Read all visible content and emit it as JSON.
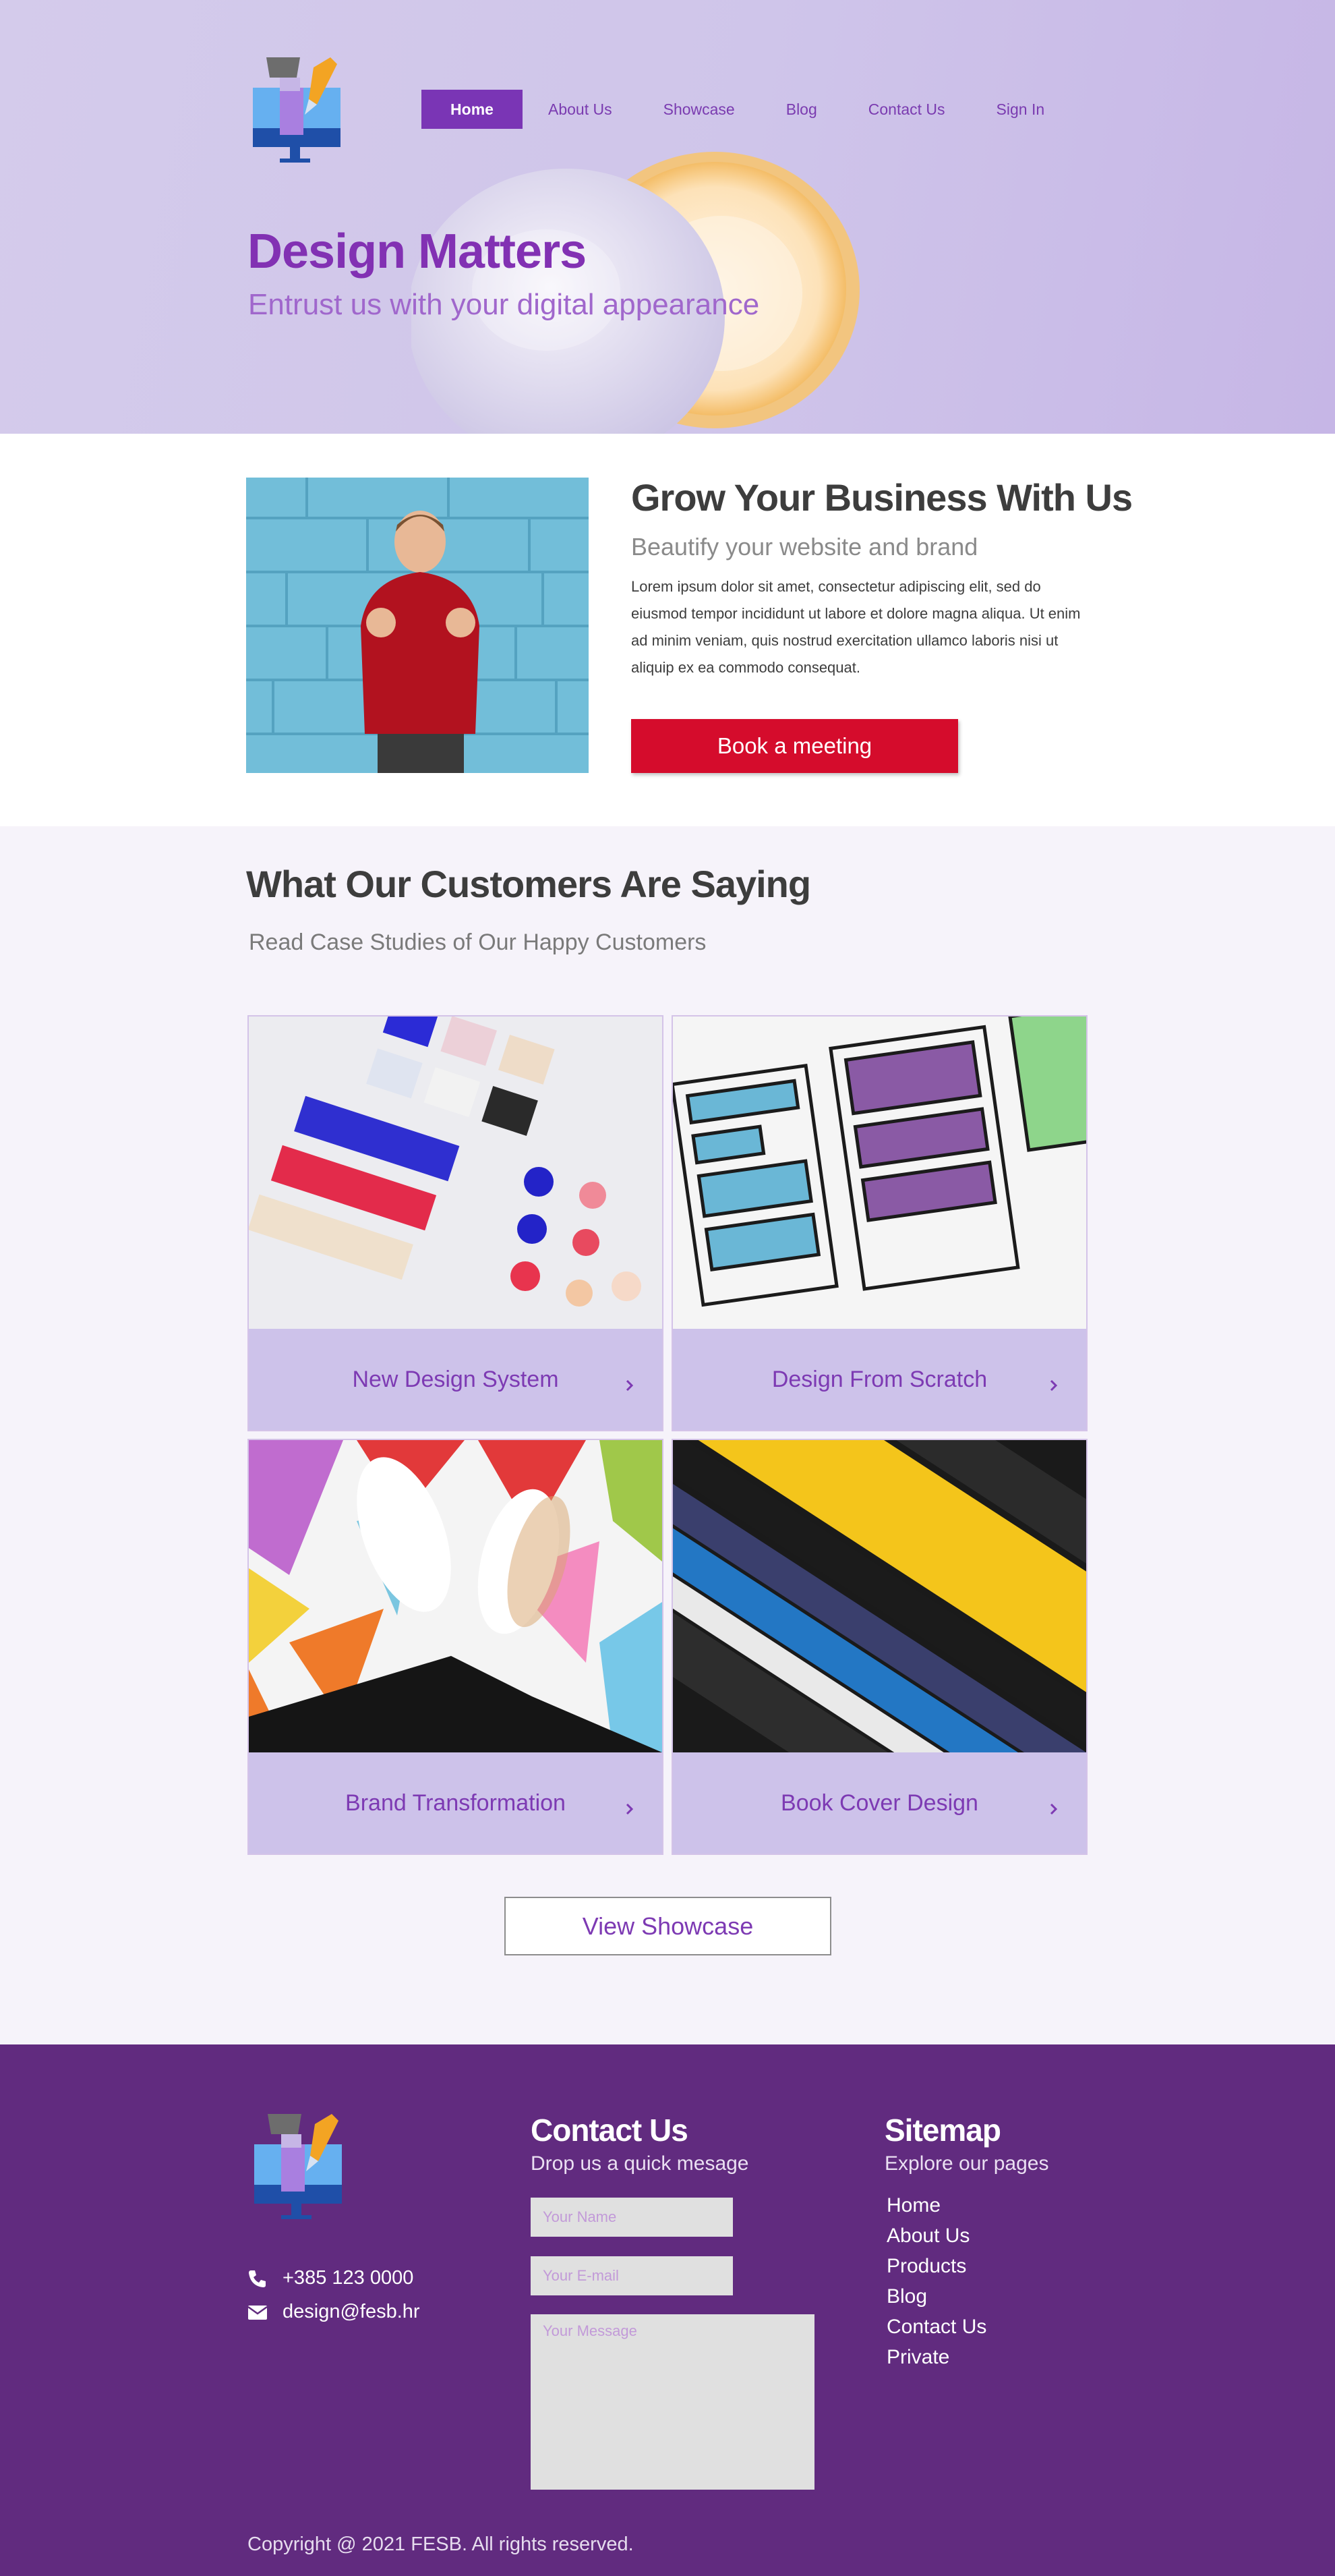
{
  "nav": {
    "items": [
      "Home",
      "About Us",
      "Showcase",
      "Blog",
      "Contact Us",
      "Sign In"
    ],
    "active": "Home"
  },
  "hero": {
    "title": "Design Matters",
    "subtitle": "Entrust us with your digital appearance"
  },
  "grow": {
    "title": "Grow Your Business With Us",
    "subtitle": "Beautify your website and brand",
    "body": "Lorem ipsum dolor sit amet, consectetur adipiscing elit, sed do eiusmod tempor incididunt ut labore et dolore magna aliqua. Ut enim ad minim veniam, quis nostrud exercitation ullamco laboris nisi ut aliquip ex ea commodo consequat.",
    "button": "Book a meeting"
  },
  "customers": {
    "title": "What Our Customers Are Saying",
    "subtitle": "Read Case Studies of Our Happy Customers",
    "cards": [
      {
        "label": "New Design System"
      },
      {
        "label": "Design From Scratch"
      },
      {
        "label": "Brand Transformation"
      },
      {
        "label": "Book Cover Design"
      }
    ],
    "button": "View Showcase"
  },
  "footer": {
    "phone": "+385 123 0000",
    "email": "design@fesb.hr",
    "contact": {
      "title": "Contact Us",
      "subtitle": "Drop us a quick mesage",
      "name_placeholder": "Your Name",
      "email_placeholder": "Your E-mail",
      "message_placeholder": "Your Message"
    },
    "sitemap": {
      "title": "Sitemap",
      "subtitle": "Explore our pages",
      "links": [
        "Home",
        "About Us",
        "Products",
        "Blog",
        "Contact Us",
        "Private"
      ]
    },
    "copyright": "Copyright @ 2021 FESB. All rights reserved."
  },
  "colors": {
    "primary_purple": "#7a35b5",
    "footer_purple": "#612b7f",
    "book_button_red": "#d50c2c",
    "card_lavender": "#cdc2ea"
  }
}
